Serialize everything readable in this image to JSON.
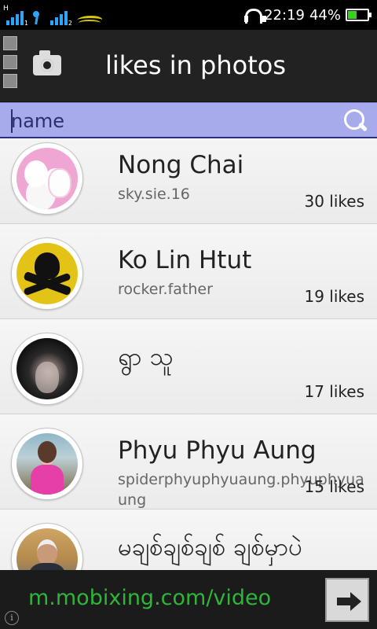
{
  "status_bar": {
    "network_tag": "H",
    "sim1_index": "1",
    "sim2_index": "2",
    "time": "22:19",
    "battery_percent_label": "44%",
    "battery_level": 0.44,
    "icons": [
      "signal-icon",
      "carrier-icon",
      "signal-icon",
      "wave-icon",
      "headphone-icon",
      "battery-icon"
    ]
  },
  "header": {
    "title": "likes in photos",
    "icons": [
      "menu-icon",
      "camera-icon"
    ]
  },
  "search": {
    "placeholder": "name",
    "icon": "search-icon"
  },
  "friends": [
    {
      "name": "Nong Chai",
      "username": "sky.sie.16",
      "likes": "30 likes"
    },
    {
      "name": "Ko Lin Htut",
      "username": "rocker.father",
      "likes": "19 likes"
    },
    {
      "name": "ရွာ သူ",
      "username": "",
      "likes": "17 likes"
    },
    {
      "name": "Phyu Phyu Aung",
      "username": "spiderphyuphyuaung.phyuphyuaung",
      "likes": "15 likes"
    },
    {
      "name": "မချစ်ချစ်ချစ် ချစ်မှာပဲ",
      "username": "",
      "likes": ""
    }
  ],
  "ad": {
    "text": "m.mobixing.com/video",
    "info_label": "i",
    "icons": [
      "arrow-right-icon",
      "info-icon"
    ]
  },
  "colors": {
    "search_bg": "#a8abeb",
    "appbar_bg": "#222222",
    "ad_text": "#2fb63a",
    "battery_fill": "#35d21e"
  }
}
